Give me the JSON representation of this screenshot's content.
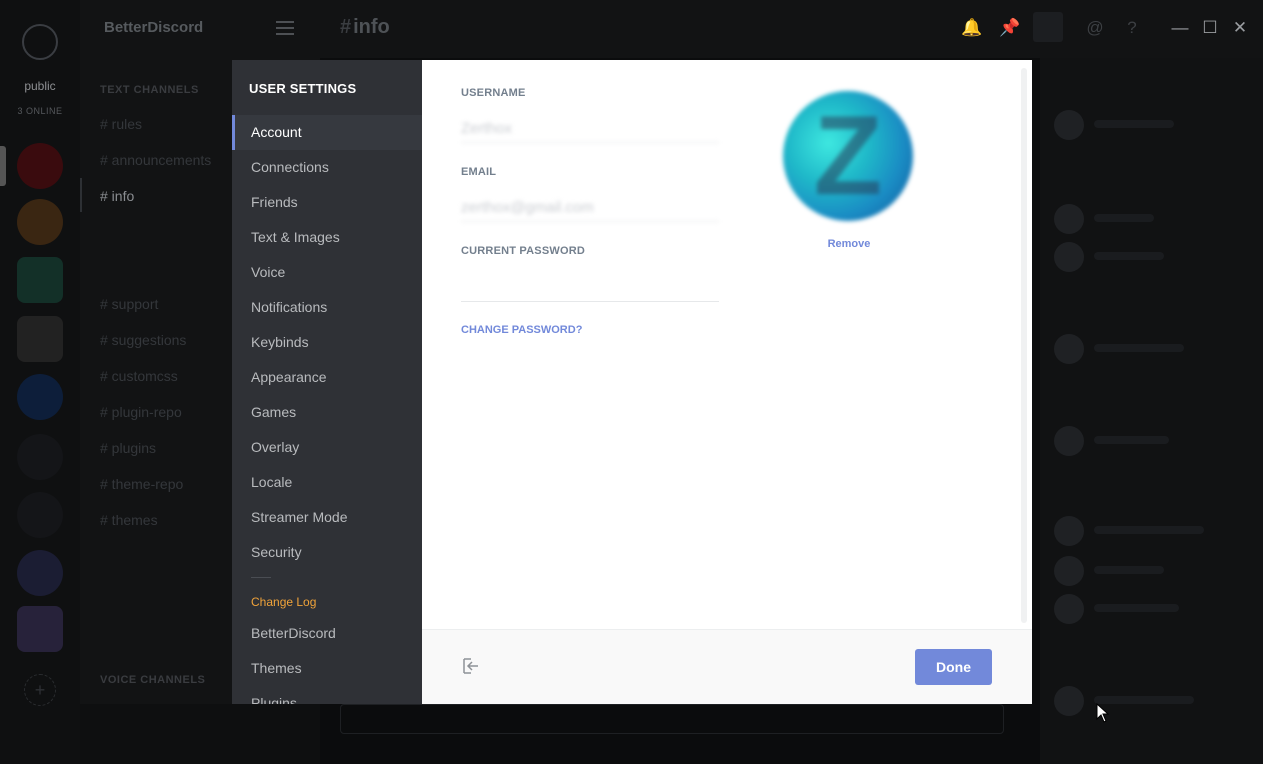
{
  "background": {
    "guilds": {
      "public_label": "public",
      "online_label": "3 ONLINE"
    },
    "server_name": "BetterDiscord",
    "categories": {
      "text": "TEXT CHANNELS",
      "voice": "VOICE CHANNELS"
    },
    "channels": [
      "# rules",
      "# announcements",
      "# info",
      "# support",
      "# suggestions",
      "# customcss",
      "# plugin-repo",
      "# plugins",
      "# theme-repo",
      "# themes"
    ],
    "active_channel": "info",
    "topbar_title": "info",
    "topbar_hash": "#"
  },
  "modal": {
    "sidebar": {
      "header": "USER SETTINGS",
      "items": [
        {
          "label": "Account"
        },
        {
          "label": "Connections"
        },
        {
          "label": "Friends"
        },
        {
          "label": "Text & Images"
        },
        {
          "label": "Voice"
        },
        {
          "label": "Notifications"
        },
        {
          "label": "Keybinds"
        },
        {
          "label": "Appearance"
        },
        {
          "label": "Games"
        },
        {
          "label": "Overlay"
        },
        {
          "label": "Locale"
        },
        {
          "label": "Streamer Mode"
        },
        {
          "label": "Security"
        }
      ],
      "changelog": "Change Log",
      "extra_items": [
        {
          "label": "BetterDiscord"
        },
        {
          "label": "Themes"
        },
        {
          "label": "Plugins"
        }
      ]
    },
    "account": {
      "username_label": "USERNAME",
      "username_value": "Zerthox",
      "email_label": "EMAIL",
      "email_value": "zerthox@gmail.com",
      "password_label": "CURRENT PASSWORD",
      "password_value": "",
      "change_password": "CHANGE PASSWORD?",
      "remove_avatar": "Remove"
    },
    "footer": {
      "done": "Done"
    }
  },
  "colors": {
    "accent": "#7289da",
    "changelog": "#f0a33a",
    "sidebar": "#2f3136"
  }
}
